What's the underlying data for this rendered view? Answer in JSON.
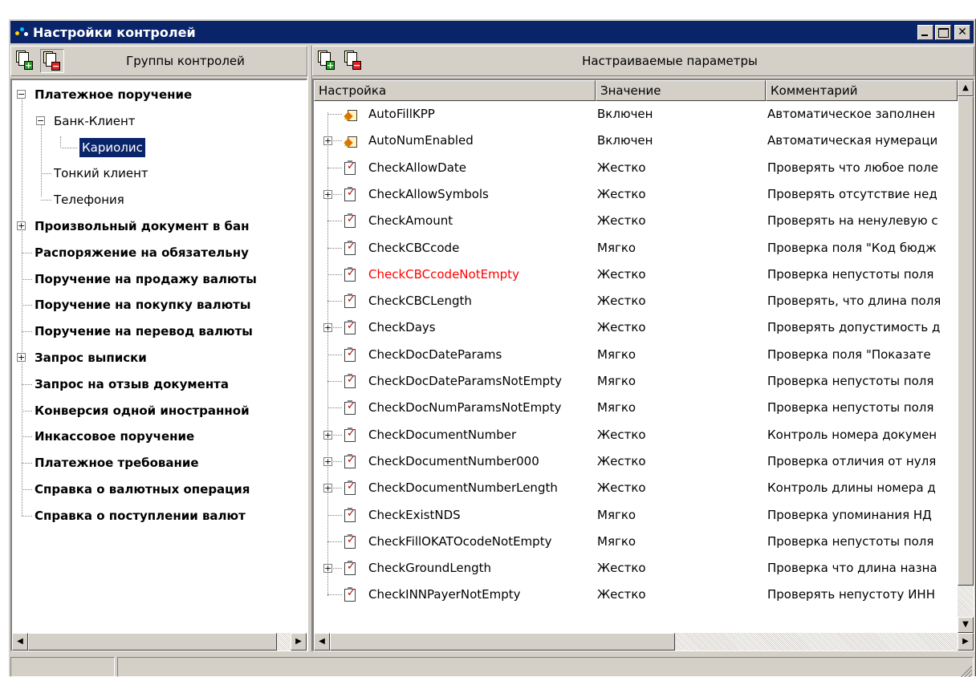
{
  "window": {
    "title": "Настройки контролей",
    "buttons": {
      "minimize": "_",
      "maximize": "□",
      "close": "✕"
    }
  },
  "left_panel": {
    "caption": "Группы контролей",
    "tree": [
      {
        "label": "Платежное поручение",
        "bold": true,
        "expander": "−",
        "level": 0
      },
      {
        "label": "Банк-Клиент",
        "bold": false,
        "expander": "−",
        "level": 1
      },
      {
        "label": "Кариолис",
        "bold": false,
        "expander": "",
        "level": 2,
        "selected": true
      },
      {
        "label": "Тонкий клиент",
        "bold": false,
        "expander": "",
        "level": 1
      },
      {
        "label": "Телефония",
        "bold": false,
        "expander": "",
        "level": 1
      },
      {
        "label": "Произвольный документ в бан",
        "bold": true,
        "expander": "+",
        "level": 0
      },
      {
        "label": "Распоряжение на обязательну",
        "bold": true,
        "expander": "",
        "level": 0
      },
      {
        "label": "Поручение на продажу валюты",
        "bold": true,
        "expander": "",
        "level": 0
      },
      {
        "label": "Поручение на покупку валюты",
        "bold": true,
        "expander": "",
        "level": 0
      },
      {
        "label": "Поручение на перевод валюты",
        "bold": true,
        "expander": "",
        "level": 0
      },
      {
        "label": "Запрос выписки",
        "bold": true,
        "expander": "+",
        "level": 0
      },
      {
        "label": "Запрос на отзыв документа",
        "bold": true,
        "expander": "",
        "level": 0
      },
      {
        "label": "Конверсия одной иностранной",
        "bold": true,
        "expander": "",
        "level": 0
      },
      {
        "label": "Инкассовое поручение",
        "bold": true,
        "expander": "",
        "level": 0
      },
      {
        "label": "Платежное требование",
        "bold": true,
        "expander": "",
        "level": 0
      },
      {
        "label": "Справка о валютных операция",
        "bold": true,
        "expander": "",
        "level": 0
      },
      {
        "label": "Справка о поступлении валют",
        "bold": true,
        "expander": "",
        "level": 0
      }
    ]
  },
  "right_panel": {
    "caption": "Настраиваемые параметры",
    "columns": [
      "Настройка",
      "Значение",
      "Комментарий"
    ],
    "rows": [
      {
        "name": "AutoFillKPP",
        "value": "Включен",
        "comment": "Автоматическое заполнен",
        "icon": "wizard-icon",
        "expander": "",
        "red": false
      },
      {
        "name": "AutoNumEnabled",
        "value": "Включен",
        "comment": "Автоматическая нумераци",
        "icon": "wizard-icon",
        "expander": "+",
        "red": false
      },
      {
        "name": "CheckAllowDate",
        "value": "Жестко",
        "comment": "Проверять что любое поле",
        "icon": "checklist-icon",
        "expander": "",
        "red": false
      },
      {
        "name": "CheckAllowSymbols",
        "value": "Жестко",
        "comment": "Проверять отсутствие нед",
        "icon": "checklist-icon",
        "expander": "+",
        "red": false
      },
      {
        "name": "CheckAmount",
        "value": "Жестко",
        "comment": "Проверять на ненулевую с",
        "icon": "checklist-icon",
        "expander": "",
        "red": false
      },
      {
        "name": "CheckCBCcode",
        "value": "Мягко",
        "comment": "Проверка поля \"Код бюдж",
        "icon": "checklist-icon",
        "expander": "",
        "red": false
      },
      {
        "name": "CheckCBCcodeNotEmpty",
        "value": "Жестко",
        "comment": "Проверка непустоты поля",
        "icon": "checklist-icon",
        "expander": "",
        "red": true
      },
      {
        "name": "CheckCBCLength",
        "value": "Жестко",
        "comment": "Проверять, что длина поля",
        "icon": "checklist-icon",
        "expander": "",
        "red": false
      },
      {
        "name": "CheckDays",
        "value": "Жестко",
        "comment": "Проверять допустимость д",
        "icon": "checklist-icon",
        "expander": "+",
        "red": false
      },
      {
        "name": "CheckDocDateParams",
        "value": "Мягко",
        "comment": "Проверка поля \"Показате",
        "icon": "checklist-icon",
        "expander": "",
        "red": false
      },
      {
        "name": "CheckDocDateParamsNotEmpty",
        "value": "Мягко",
        "comment": "Проверка непустоты  поля",
        "icon": "checklist-icon",
        "expander": "",
        "red": false
      },
      {
        "name": "CheckDocNumParamsNotEmpty",
        "value": "Мягко",
        "comment": "Проверка непустоты поля",
        "icon": "checklist-icon",
        "expander": "",
        "red": false
      },
      {
        "name": "CheckDocumentNumber",
        "value": "Жестко",
        "comment": "Контроль номера докумен",
        "icon": "checklist-icon",
        "expander": "+",
        "red": false
      },
      {
        "name": "CheckDocumentNumber000",
        "value": "Жестко",
        "comment": "Проверка отличия от нуля",
        "icon": "checklist-icon",
        "expander": "+",
        "red": false
      },
      {
        "name": "CheckDocumentNumberLength",
        "value": "Жестко",
        "comment": "Контроль длины номера д",
        "icon": "checklist-icon",
        "expander": "+",
        "red": false
      },
      {
        "name": "CheckExistNDS",
        "value": "Мягко",
        "comment": "Проверка упоминания НД",
        "icon": "checklist-icon",
        "expander": "",
        "red": false
      },
      {
        "name": "CheckFillOKATOcodeNotEmpty",
        "value": "Мягко",
        "comment": "Проверка непустоты поля",
        "icon": "checklist-icon",
        "expander": "",
        "red": false
      },
      {
        "name": "CheckGroundLength",
        "value": "Жестко",
        "comment": "Проверка что длина назна",
        "icon": "checklist-icon",
        "expander": "+",
        "red": false
      },
      {
        "name": "CheckINNPayerNotEmpty",
        "value": "Жестко",
        "comment": "Проверять непустоту ИНН",
        "icon": "checklist-icon",
        "expander": "",
        "red": false
      }
    ]
  },
  "toolbar_icons": {
    "add": "add-document-icon",
    "delete": "delete-document-icon"
  },
  "colors": {
    "title_bar": "#0a246a",
    "face": "#d4d0c8",
    "selection": "#0a246a",
    "warning_text": "#ff0000"
  }
}
